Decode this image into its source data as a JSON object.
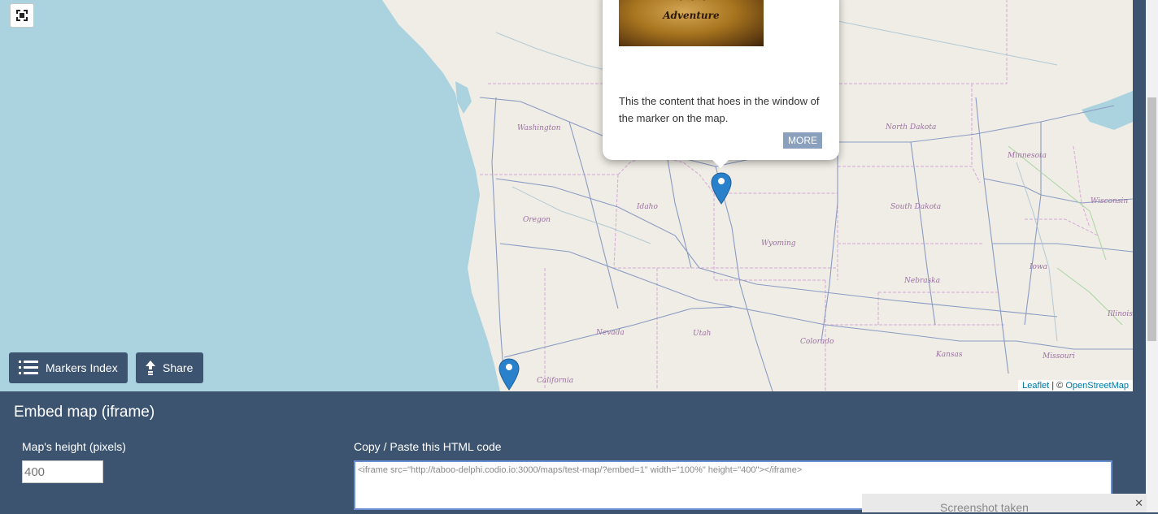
{
  "map": {
    "state_labels": [
      "Washington",
      "Oregon",
      "Idaho",
      "Nevada",
      "California",
      "Utah",
      "Wyoming",
      "Colorado",
      "North Dakota",
      "South Dakota",
      "Nebraska",
      "Kansas",
      "Minnesota",
      "Wisconsin",
      "Iowa",
      "Illinois",
      "Missouri"
    ],
    "markers_index_label": "Markers Index",
    "share_label": "Share",
    "popup": {
      "image_caption": "Adventure",
      "content": "This the content that hoes in the window of the marker on the map.",
      "more_label": "MORE"
    },
    "attribution": {
      "leaflet": "Leaflet",
      "sep": " | © ",
      "osm": "OpenStreetMap"
    }
  },
  "embed": {
    "title": "Embed map (iframe)",
    "height_label": "Map's height (pixels)",
    "height_value": "400",
    "code_label": "Copy / Paste this HTML code",
    "code_value": "<iframe src=\"http://taboo-delphi.codio.io:3000/maps/test-map/?embed=1\" width=\"100%\" height=\"400\"></iframe>"
  },
  "toast": {
    "text": "Screenshot taken",
    "close": "✕"
  },
  "colors": {
    "water": "#aad3df",
    "land": "#f0ede6",
    "panel": "#3d5470",
    "marker": "#2a81cb"
  }
}
